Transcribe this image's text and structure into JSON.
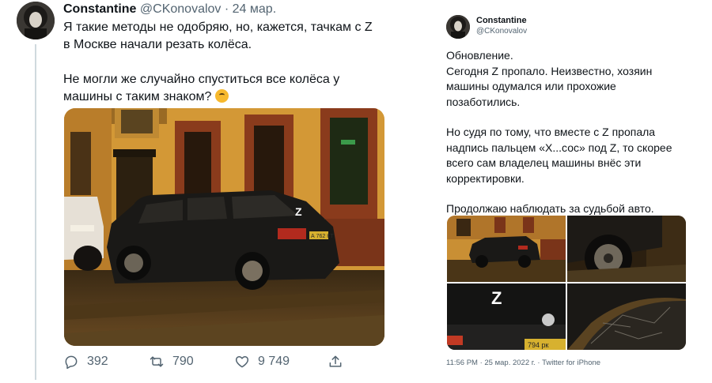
{
  "tweet1": {
    "author_name": "Constantine",
    "author_handle": "@CKonovalov",
    "separator": "·",
    "date": "24 мар.",
    "text_p1": "Я такие методы не одобряю, но, кажется, тачкам с Z в Москве начали резать колёса.",
    "text_p2": "Не могли же случайно спуститься все колёса у машины с таким знаком?",
    "emoji_icon": "thinking-face-emoji",
    "photo_car_letter": "Z",
    "photo_plate_text": "А 762 КТ",
    "reply_count": "392",
    "retweet_count": "790",
    "like_count": "9 749"
  },
  "tweet2": {
    "author_name": "Constantine",
    "author_handle": "@CKonovalov",
    "text_p1": "Обновление.\nСегодня Z пропало. Неизвестно, хозяин машины одумался или прохожие позаботились.",
    "text_p2": "Но судя по тому, что вместе с Z пропала надпись пальцем «Х...сос» под Z, то скорее всего сам владелец машины внёс эти корректировки.",
    "text_p3": "Продолжаю наблюдать за судьбой авто.",
    "photo_z_letter": "Z",
    "photo_plate_partial": "794 рк",
    "footer": "11:56 PM · 25 мар. 2022 г. · Twitter for iPhone"
  },
  "colors": {
    "text_primary": "#0f1419",
    "text_secondary": "#536471",
    "thread_line": "#cfd9de",
    "brick": "#8a3b1c",
    "facade": "#d9a03a"
  }
}
